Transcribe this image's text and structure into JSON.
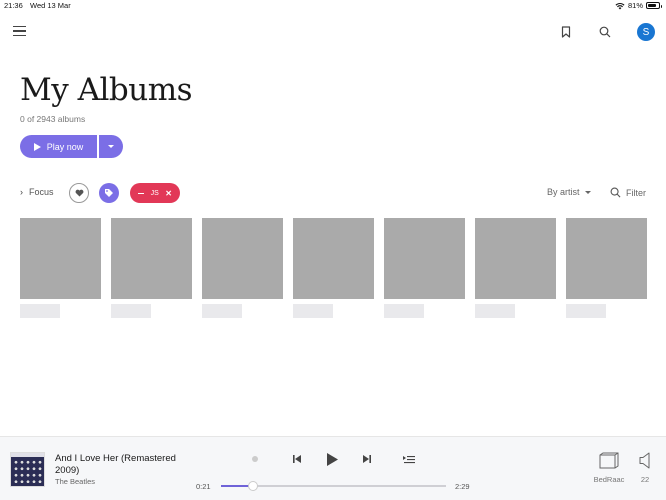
{
  "status_bar": {
    "time": "21:36",
    "date": "Wed 13 Mar",
    "battery": "81%",
    "battery_level": 0.81
  },
  "header": {
    "menu_icon": "hamburger-icon",
    "bookmark_icon": "bookmark-icon",
    "search_icon": "search-icon",
    "avatar_initial": "S",
    "avatar_color": "#1976d2"
  },
  "page": {
    "title": "My Albums",
    "count": "0 of 2943 albums",
    "play_label": "Play now"
  },
  "filters": {
    "focus_label": "Focus",
    "chip_label": "JS",
    "sort_label": "By artist",
    "filter_label": "Filter"
  },
  "colors": {
    "accent": "#7b6ee6",
    "chip": "#e23857",
    "placeholder": "#aaaaaa"
  },
  "albums": [
    {
      "state": "loading"
    },
    {
      "state": "loading"
    },
    {
      "state": "loading"
    },
    {
      "state": "loading"
    },
    {
      "state": "loading"
    },
    {
      "state": "loading"
    },
    {
      "state": "loading"
    }
  ],
  "player": {
    "title": "And I Love Her (Remastered 2009)",
    "artist": "The Beatles",
    "elapsed": "0:21",
    "duration": "2:29",
    "progress": 0.14,
    "device": "BedRaac",
    "volume": "22"
  }
}
